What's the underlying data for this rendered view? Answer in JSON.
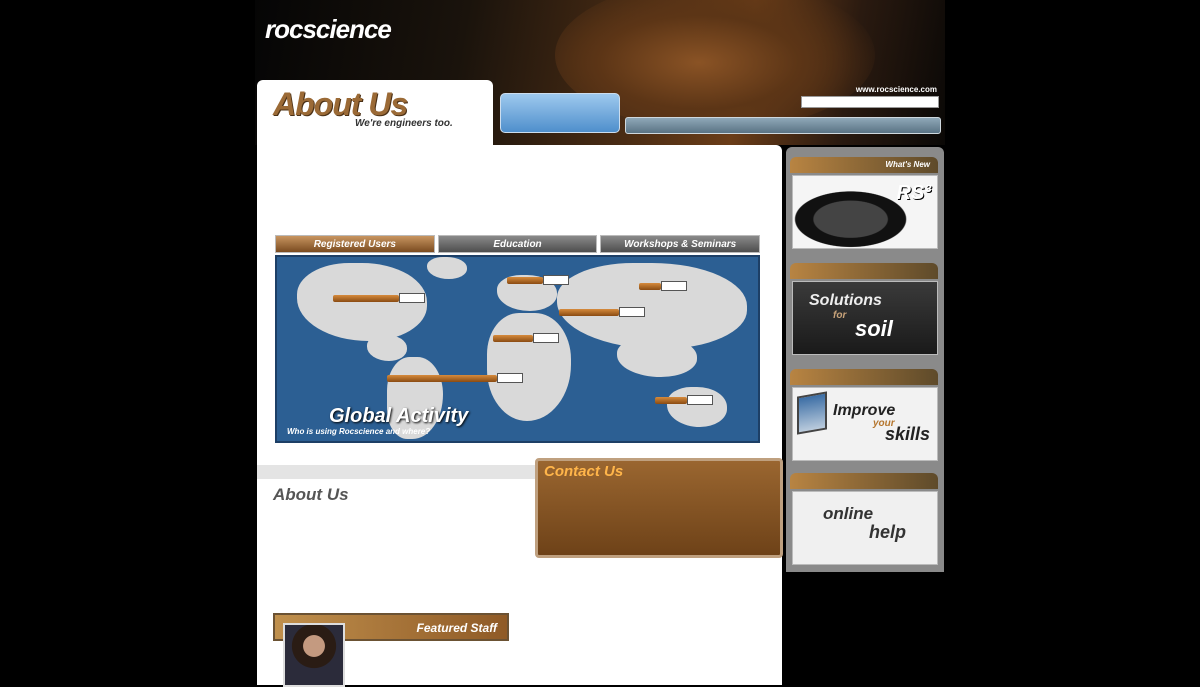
{
  "header": {
    "logo": "rocscience",
    "logo_tagline": "",
    "top_links": [
      "",
      ""
    ],
    "url": "www.rocscience.com",
    "nav": [
      "",
      "",
      "",
      ""
    ],
    "blue_box": {
      "title": "",
      "left": "",
      "right": ""
    }
  },
  "page_title": "About Us",
  "page_subtitle": "We're engineers too.",
  "intro": "",
  "tabs": [
    {
      "label": "Registered Users"
    },
    {
      "label": "Education"
    },
    {
      "label": "Workshops & Seminars"
    }
  ],
  "map": {
    "title": "Global Activity",
    "subtitle": "Who is using Rocscience and where?",
    "pins": [
      {
        "label": "",
        "value": ""
      },
      {
        "label": "",
        "value": ""
      },
      {
        "label": "",
        "value": ""
      },
      {
        "label": "",
        "value": ""
      },
      {
        "label": "",
        "value": ""
      },
      {
        "label": "",
        "value": ""
      },
      {
        "label": "",
        "value": ""
      }
    ]
  },
  "about": {
    "heading": "About Us",
    "para1": "",
    "para2": ""
  },
  "contact": {
    "heading": "Contact Us",
    "body": "",
    "details": ""
  },
  "staff": {
    "heading": "Featured Staff",
    "name": "",
    "role": "",
    "bio": ""
  },
  "sidebar": {
    "sections": [
      {
        "heading": "What's New",
        "image_text": "RS³"
      },
      {
        "heading": "",
        "image_text": "Solutions for soil"
      },
      {
        "heading": "",
        "image_text": "Improve your skills"
      },
      {
        "heading": "",
        "image_text": "online help"
      }
    ],
    "img_words": {
      "soil1": "Solutions",
      "soil2": "for",
      "soil3": "soil",
      "wk1": "Improve",
      "wk2": "your",
      "wk3": "skills",
      "h1": "online",
      "h2": "help"
    }
  },
  "colors": {
    "accent": "#9b6a36",
    "contact_bg": "#7e4e22",
    "map_bg": "#2c5f93"
  }
}
